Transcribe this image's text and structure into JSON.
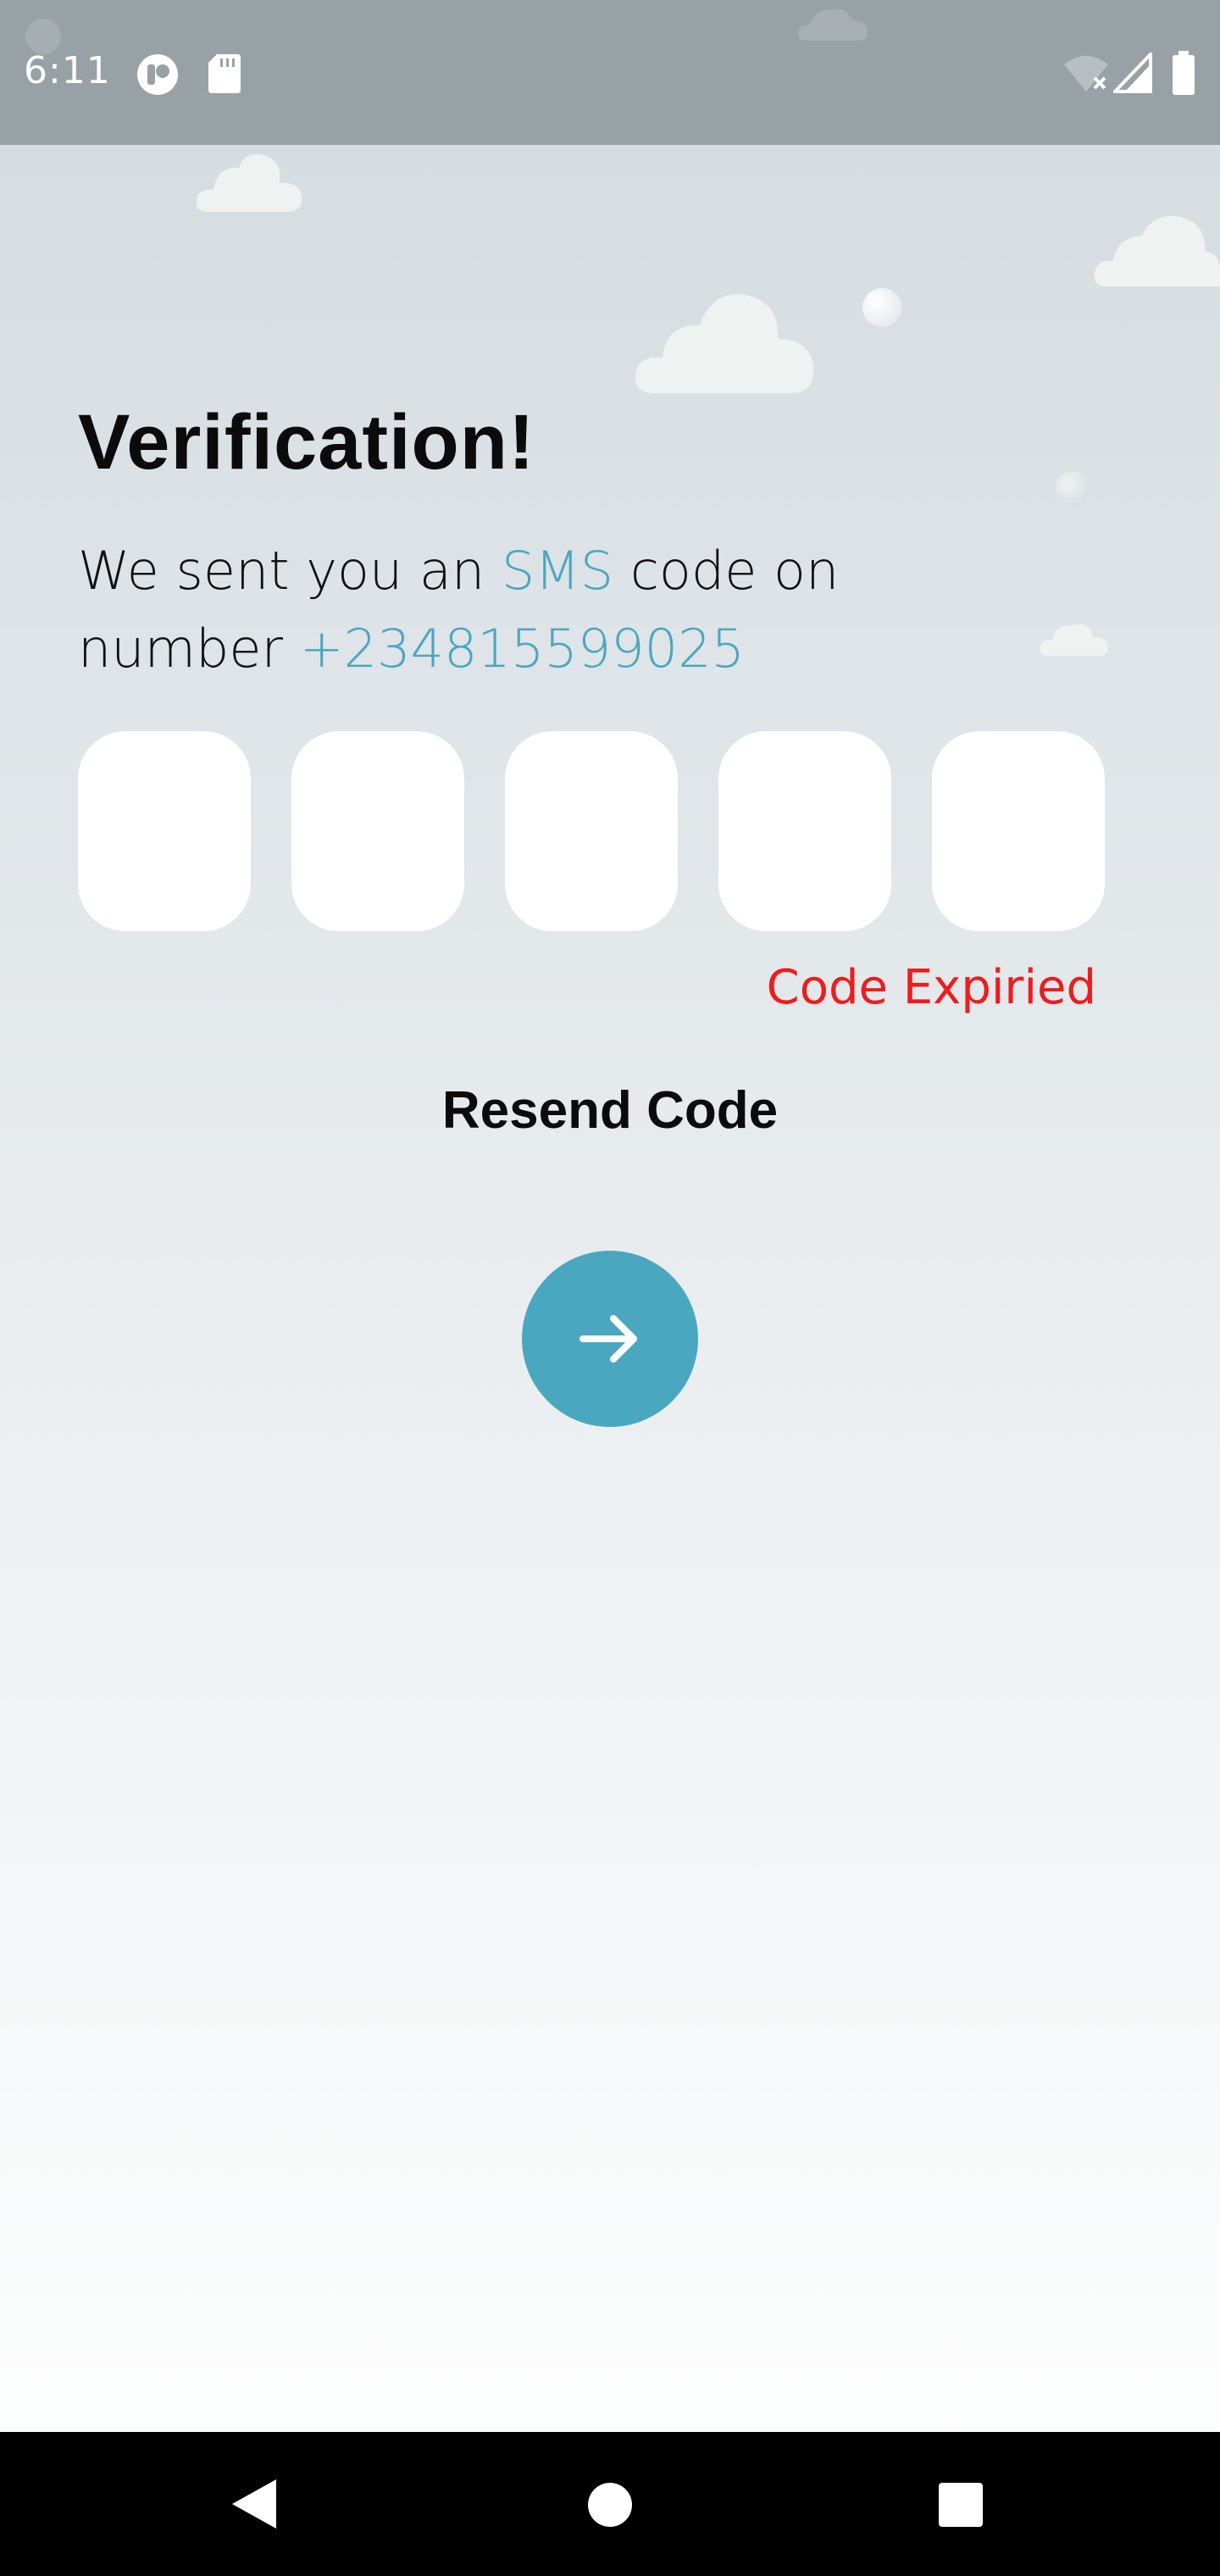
{
  "status_bar": {
    "time": "6:11",
    "icons": [
      "notification-app-icon",
      "sd-card-icon",
      "wifi-off-icon",
      "cellular-signal-icon",
      "battery-icon"
    ]
  },
  "verification": {
    "title": "Verification!",
    "subtitle_part1": "We sent you an ",
    "subtitle_highlight": "SMS",
    "subtitle_part2": " code on number ",
    "phone_number": "+234815599025",
    "code_digits": [
      "",
      "",
      "",
      "",
      ""
    ],
    "error_message": "Code Expiried",
    "resend_label": "Resend Code"
  },
  "navigation_bar": {
    "buttons": [
      "back-icon",
      "home-icon",
      "recents-icon"
    ]
  },
  "colors": {
    "accent": "#49a8bf",
    "error": "#ee1c1c",
    "status_bar": "#98a1a5"
  }
}
